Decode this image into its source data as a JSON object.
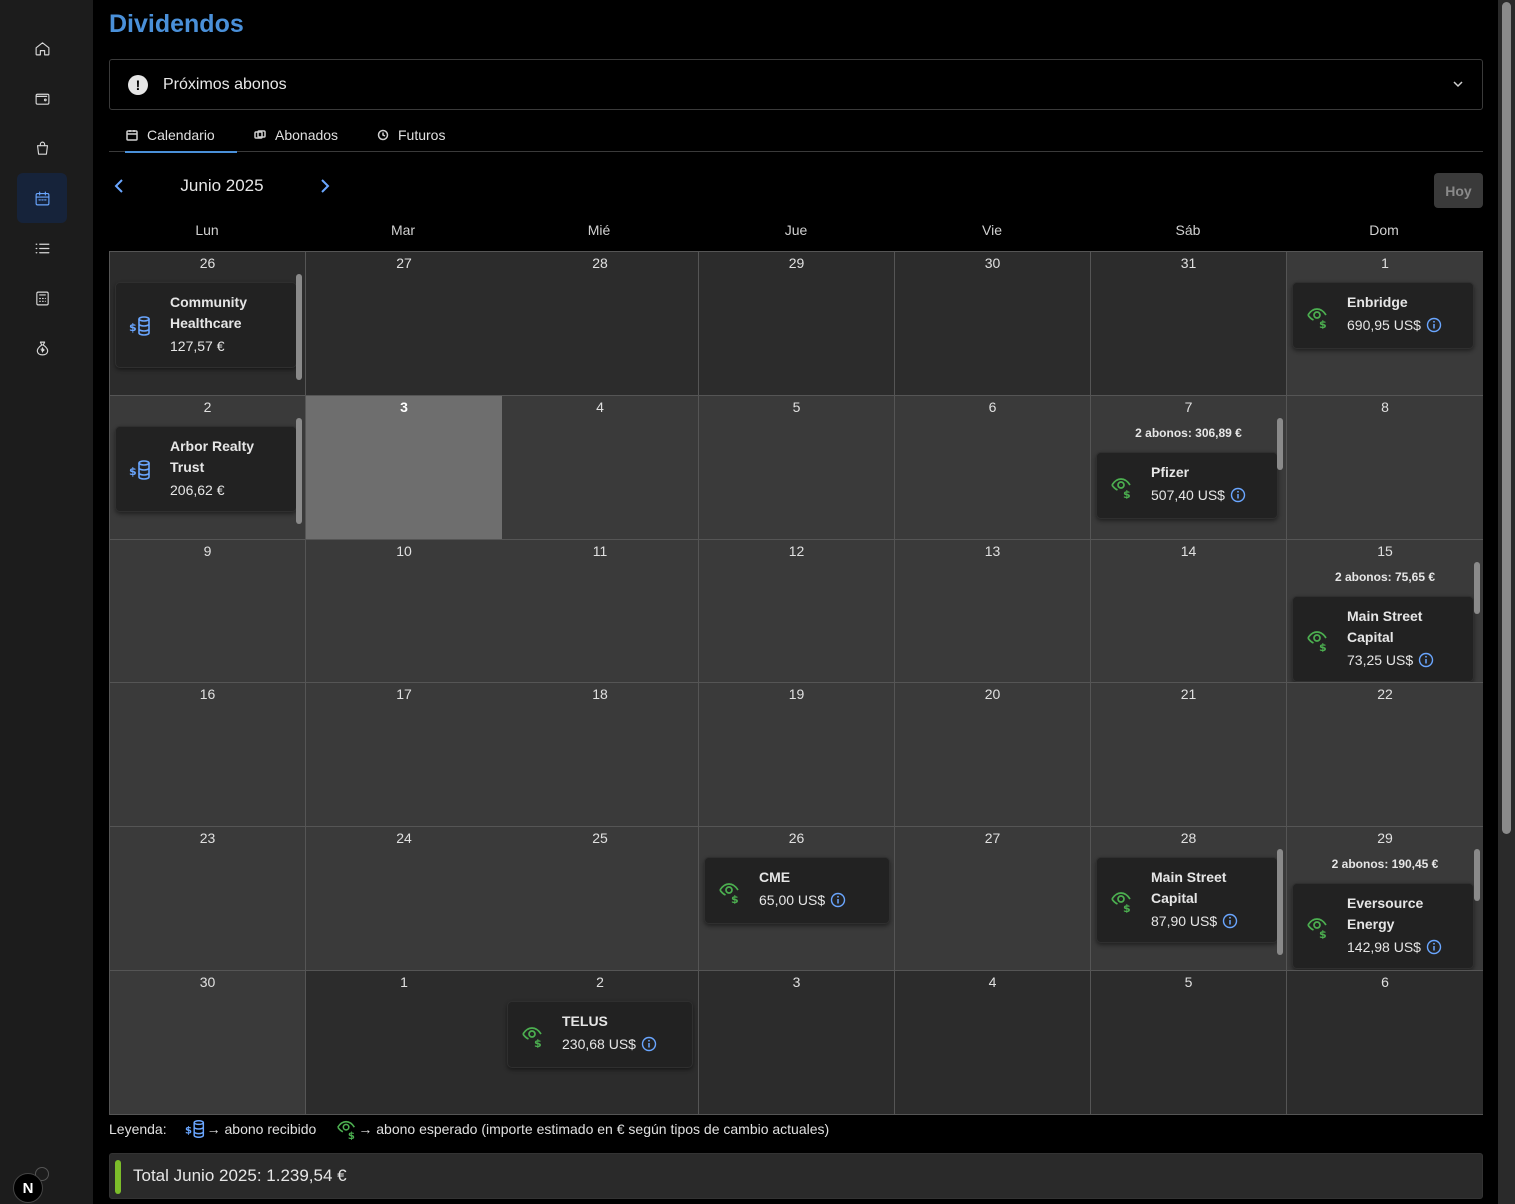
{
  "sidebar": {
    "items": [
      {
        "name": "home-icon",
        "active": false
      },
      {
        "name": "wallet-icon",
        "active": false
      },
      {
        "name": "shopping-bag-icon",
        "active": false
      },
      {
        "name": "calendar-icon",
        "active": true
      },
      {
        "name": "list-icon",
        "active": false
      },
      {
        "name": "calculator-icon",
        "active": false
      },
      {
        "name": "money-bag-icon",
        "active": false
      }
    ],
    "badge": "N"
  },
  "page_title": "Dividendos",
  "upcoming": {
    "label": "Próximos abonos",
    "icon": "alert-icon"
  },
  "tabs": [
    {
      "label": "Calendario",
      "icon": "calendar-check-icon",
      "active": true
    },
    {
      "label": "Abonados",
      "icon": "coins-icon",
      "active": false
    },
    {
      "label": "Futuros",
      "icon": "clock-icon",
      "active": false
    }
  ],
  "month_label": "Junio 2025",
  "today_button": "Hoy",
  "weekdays": [
    "Lun",
    "Mar",
    "Mié",
    "Jue",
    "Vie",
    "Sáb",
    "Dom"
  ],
  "weeks": [
    [
      {
        "n": "26",
        "c": "other"
      },
      {
        "n": "27",
        "c": "other"
      },
      {
        "n": "28",
        "c": "other"
      },
      {
        "n": "29",
        "c": "other"
      },
      {
        "n": "30",
        "c": "other"
      },
      {
        "n": "31",
        "c": "other"
      },
      {
        "n": "1",
        "c": "cur"
      }
    ],
    [
      {
        "n": "2",
        "c": "cur"
      },
      {
        "n": "3",
        "c": "today"
      },
      {
        "n": "4",
        "c": "cur"
      },
      {
        "n": "5",
        "c": "cur"
      },
      {
        "n": "6",
        "c": "cur"
      },
      {
        "n": "7",
        "c": "cur",
        "summary": "2 abonos: 306,89 €"
      },
      {
        "n": "8",
        "c": "cur"
      }
    ],
    [
      {
        "n": "9",
        "c": "cur"
      },
      {
        "n": "10",
        "c": "cur"
      },
      {
        "n": "11",
        "c": "cur"
      },
      {
        "n": "12",
        "c": "cur"
      },
      {
        "n": "13",
        "c": "cur"
      },
      {
        "n": "14",
        "c": "cur"
      },
      {
        "n": "15",
        "c": "cur",
        "summary": "2 abonos: 75,65 €"
      }
    ],
    [
      {
        "n": "16",
        "c": "cur"
      },
      {
        "n": "17",
        "c": "cur"
      },
      {
        "n": "18",
        "c": "cur"
      },
      {
        "n": "19",
        "c": "cur"
      },
      {
        "n": "20",
        "c": "cur"
      },
      {
        "n": "21",
        "c": "cur"
      },
      {
        "n": "22",
        "c": "cur"
      }
    ],
    [
      {
        "n": "23",
        "c": "cur"
      },
      {
        "n": "24",
        "c": "cur"
      },
      {
        "n": "25",
        "c": "cur"
      },
      {
        "n": "26",
        "c": "cur"
      },
      {
        "n": "27",
        "c": "cur"
      },
      {
        "n": "28",
        "c": "cur"
      },
      {
        "n": "29",
        "c": "cur",
        "summary": "2 abonos: 190,45 €"
      }
    ],
    [
      {
        "n": "30",
        "c": "cur"
      },
      {
        "n": "1",
        "c": "other"
      },
      {
        "n": "2",
        "c": "other"
      },
      {
        "n": "3",
        "c": "other"
      },
      {
        "n": "4",
        "c": "other"
      },
      {
        "n": "5",
        "c": "other"
      },
      {
        "n": "6",
        "c": "other"
      }
    ]
  ],
  "events": [
    {
      "week": 0,
      "day": 0,
      "type": "received",
      "lines": [
        "Community",
        "Healthcare"
      ],
      "amount": "127,57 €",
      "info": false
    },
    {
      "week": 0,
      "day": 6,
      "type": "expected",
      "lines": [
        "Enbridge"
      ],
      "amount": "690,95 US$",
      "info": true
    },
    {
      "week": 1,
      "day": 0,
      "type": "received",
      "lines": [
        "Arbor Realty",
        "Trust"
      ],
      "amount": "206,62 €",
      "info": false
    },
    {
      "week": 1,
      "day": 5,
      "type": "expected",
      "lines": [
        "Pfizer"
      ],
      "amount": "507,40 US$",
      "info": true
    },
    {
      "week": 2,
      "day": 6,
      "type": "expected",
      "lines": [
        "Main Street",
        "Capital"
      ],
      "amount": "73,25 US$",
      "info": true
    },
    {
      "week": 4,
      "day": 3,
      "type": "expected",
      "lines": [
        "CME"
      ],
      "amount": "65,00 US$",
      "info": true
    },
    {
      "week": 4,
      "day": 5,
      "type": "expected",
      "lines": [
        "Main Street",
        "Capital"
      ],
      "amount": "87,90 US$",
      "info": true
    },
    {
      "week": 4,
      "day": 6,
      "type": "expected",
      "lines": [
        "Eversource",
        "Energy"
      ],
      "amount": "142,98 US$",
      "info": true
    },
    {
      "week": 5,
      "day": 2,
      "type": "expected",
      "lines": [
        "TELUS"
      ],
      "amount": "230,68 US$",
      "info": true
    }
  ],
  "legend": {
    "label": "Leyenda:",
    "received": "→ abono recibido",
    "expected": "→ abono esperado (importe estimado en € según tipos de cambio actuales)"
  },
  "total": "Total Junio 2025: 1.239,54 €",
  "colors": {
    "accent": "#4a90d9",
    "received_icon": "#6aa6ff",
    "expected_icon": "#4caf50",
    "total_bar": "#7cbd2a"
  }
}
